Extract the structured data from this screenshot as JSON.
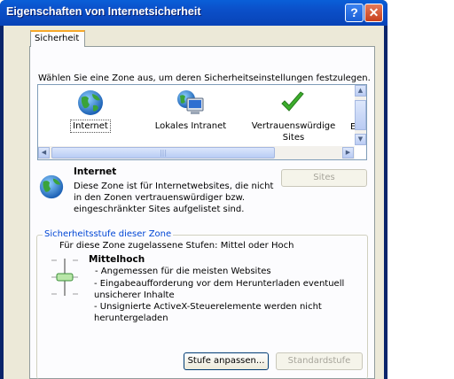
{
  "window": {
    "title": "Eigenschaften von Internetsicherheit",
    "help_label": "?",
    "close_label": "✕"
  },
  "tabs": [
    {
      "label": "Sicherheit"
    }
  ],
  "zones": {
    "prompt": "Wählen Sie eine Zone aus, um deren Sicherheitseinstellungen festzulegen.",
    "items": [
      {
        "label": "Internet",
        "icon": "globe-icon"
      },
      {
        "label": "Lokales Intranet",
        "icon": "intranet-computer-icon"
      },
      {
        "label": "Vertrauenswürdige Sites",
        "icon": "checkmark-icon"
      },
      {
        "label": "E",
        "icon": ""
      }
    ]
  },
  "selected_zone": {
    "name": "Internet",
    "description": "Diese Zone ist für Internetwebsites, die nicht in den Zonen vertrauenswürdiger bzw. eingeschränkter Sites aufgelistet sind.",
    "sites_button": "Sites"
  },
  "security_level": {
    "group_title": "Sicherheitsstufe dieser Zone",
    "allowed_levels": "Für diese Zone zugelassene Stufen: Mittel oder Hoch",
    "level_name": "Mittelhoch",
    "bullets": [
      "- Angemessen für die meisten Websites",
      "- Eingabeaufforderung vor dem Herunterladen eventuell unsicherer Inhalte",
      "- Unsignierte ActiveX-Steuerelemente werden nicht heruntergeladen"
    ],
    "custom_button": "Stufe anpassen...",
    "default_button": "Standardstufe"
  },
  "colors": {
    "titlebar": "#0b4fc8",
    "legend": "#0046d5",
    "face": "#ece9d8"
  }
}
